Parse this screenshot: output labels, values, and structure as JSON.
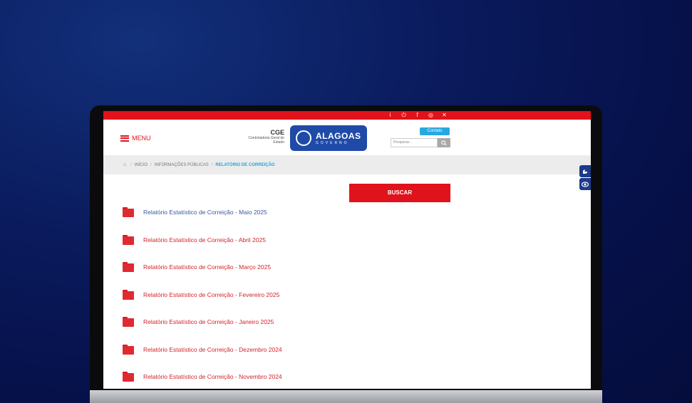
{
  "topbar": {
    "icons": [
      "info-icon",
      "power-icon",
      "facebook-icon",
      "instagram-icon",
      "x-icon"
    ],
    "glyphs": [
      "i",
      "⏻",
      "f",
      "◎",
      "✕"
    ]
  },
  "header": {
    "menu_label": "MENU",
    "cge_title": "CGE",
    "cge_subtitle": "Controladoria Geral de Estado",
    "logo_main": "ALAGOAS",
    "logo_sub": "GOVERNO",
    "contact_label": "Contato",
    "search_placeholder": "Pesquisar..."
  },
  "breadcrumb": {
    "items": [
      "INÍCIO",
      "INFORMAÇÕES PÚBLICAS"
    ],
    "current": "RELATÓRIO DE CORREIÇÃO"
  },
  "main": {
    "search_button": "BUSCAR",
    "documents": [
      "Relatório Estatístico de Correição - Maio 2025",
      "Relatório Estatístico de Correição - Abril 2025",
      "Relatório Estatístico de Correição - Março 2025",
      "Relatório Estatístico de Correição - Fevereiro 2025",
      "Relatório Estatístico de Correição - Janeiro 2025",
      "Relatório Estatístico de Correição - Dezembro 2024",
      "Relatório Estatístico de Correição - Novembro 2024"
    ]
  },
  "colors": {
    "brand_red": "#e0121b",
    "brand_blue": "#1f4aa8",
    "link_blue": "#29a0da"
  }
}
